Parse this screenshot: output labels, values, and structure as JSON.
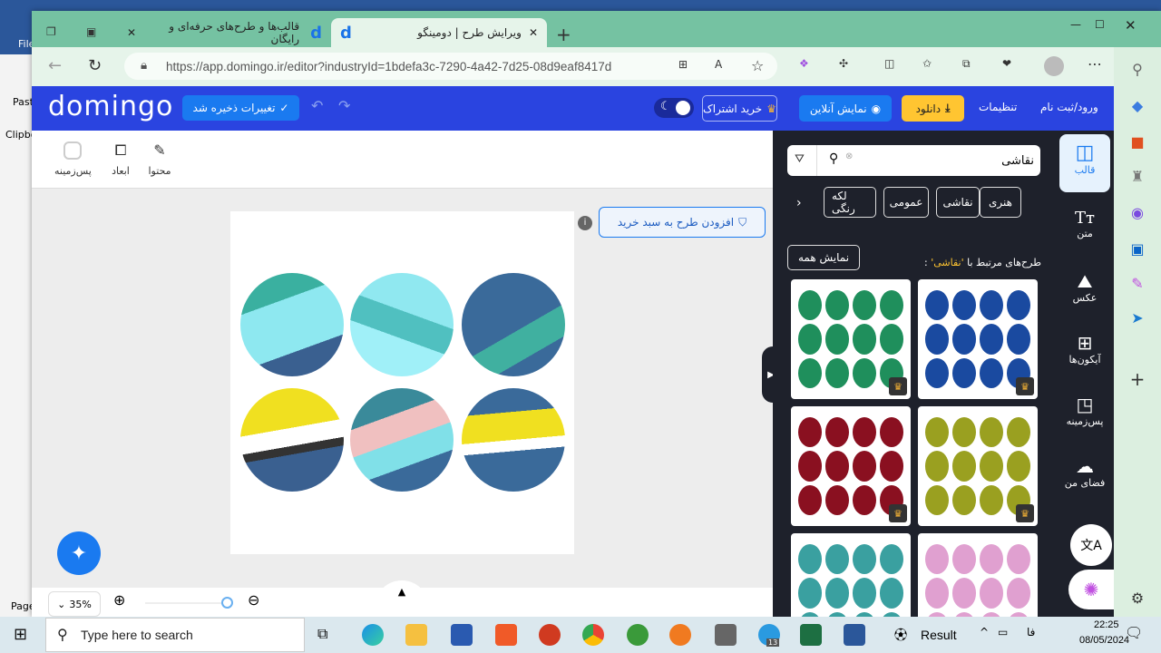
{
  "word": {
    "file": "File",
    "paste": "Paste",
    "clipboard": "Clipbo",
    "page": "Page"
  },
  "browser": {
    "tabs": [
      {
        "title": "قالب‌ها و طرح‌های حرفه‌ای و رایگان",
        "active": false
      },
      {
        "title": "ویرایش طرح | دومینگو",
        "active": true
      }
    ],
    "url": "https://app.domingo.ir/editor?industryId=1bdefa3c-7290-4a42-7d25-08d9eaf8417d"
  },
  "header": {
    "logo": "domingo",
    "saved": "تغییرات ذخیره شد",
    "subscribe": "خرید اشتراک",
    "online_preview": "نمایش آنلاین",
    "download": "دانلود",
    "settings": "تنظیمات",
    "login": "ورود/ثبت نام",
    "brand_color": "#2a44e0",
    "download_color": "#ffc531"
  },
  "toolbar": {
    "content": "محتوا",
    "dimensions": "ابعاد",
    "background": "پس‌زمینه"
  },
  "add_to_cart": "افزودن طرح به سبد خرید",
  "zoom": {
    "level": "35%"
  },
  "panel": {
    "search_value": "نقاشی",
    "chips": [
      "هنری",
      "نقاشی",
      "عمومی",
      "لکه رنگی"
    ],
    "related_prefix": "طرح‌های مرتبط با",
    "related_term": "'نقاشی'",
    "related_suffix": ":",
    "show_all": "نمایش همه",
    "templates": [
      {
        "color": "#1a4aa0"
      },
      {
        "color": "#1f8f5c"
      },
      {
        "color": "#9aa020"
      },
      {
        "color": "#8a1020"
      },
      {
        "color": "#3aa0a0"
      },
      {
        "color": "#e0a0d0"
      }
    ]
  },
  "tools": [
    "قالب",
    "متن",
    "عکس",
    "آیکون‌ها",
    "پس‌زمینه",
    "فضای من"
  ],
  "taskbar": {
    "search_placeholder": "Type here to search",
    "telegram_badge": "13",
    "result": "Result",
    "lang": "فا",
    "time": "22:25",
    "date": "08/05/2024"
  }
}
